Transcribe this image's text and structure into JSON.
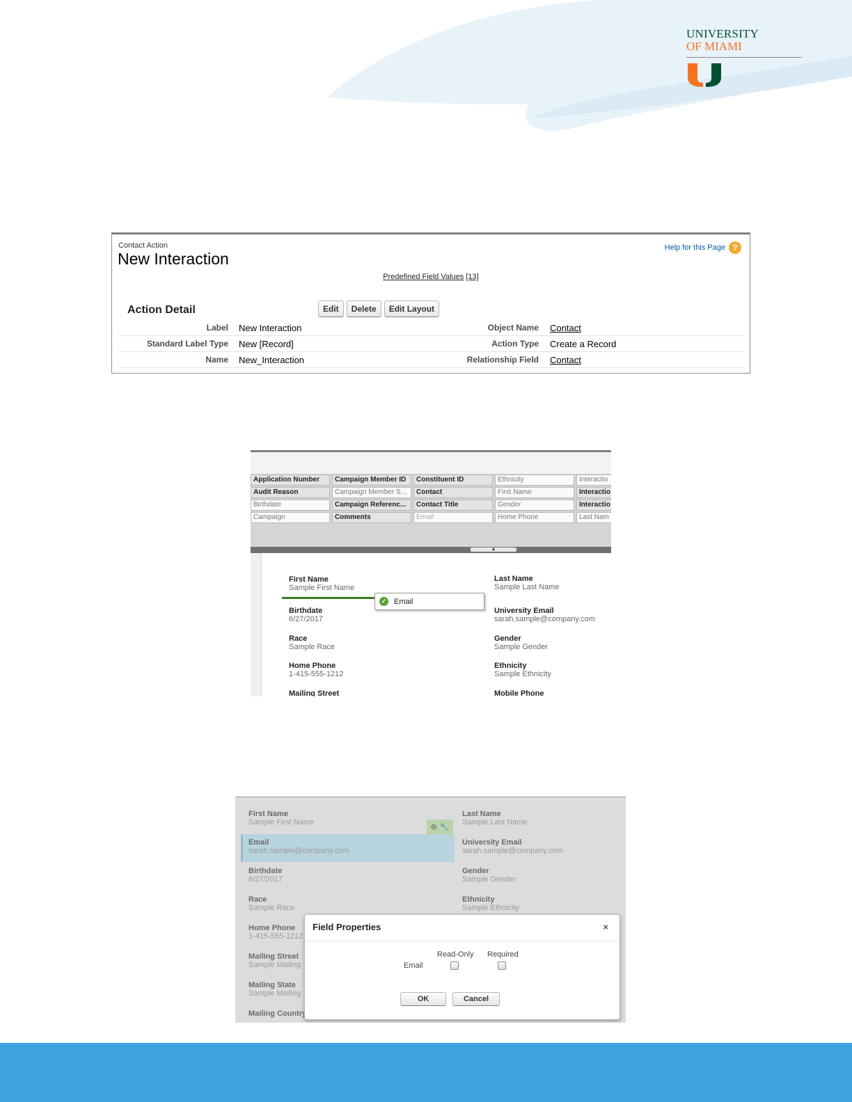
{
  "branding": {
    "university_line1": "UNIVERSITY",
    "university_line2": "OF MIAMI",
    "colors": {
      "green": "#005030",
      "orange": "#f47321",
      "footer_blue": "#3fa3e2",
      "wave": "#e6f1f8"
    }
  },
  "action_detail_page": {
    "kicker": "Contact Action",
    "title": "New Interaction",
    "help_link": "Help for this Page",
    "predefined_link": "Predefined Field Values",
    "predefined_count": "[13]",
    "section_title": "Action Detail",
    "buttons": {
      "edit": "Edit",
      "delete": "Delete",
      "edit_layout": "Edit Layout"
    },
    "rows": [
      {
        "label": "Label",
        "value": "New Interaction",
        "label2": "Object Name",
        "value2": "Contact"
      },
      {
        "label": "Standard Label Type",
        "value": "New [Record]",
        "label2": "Action Type",
        "value2": "Create a Record"
      },
      {
        "label": "Name",
        "value": "New_Interaction",
        "label2": "Relationship Field",
        "value2": "Contact"
      }
    ]
  },
  "layout_editor": {
    "palette_fields": [
      [
        "Application Number",
        "Campaign Member ID",
        "Constituent ID",
        "Ethnicity",
        "Interactio"
      ],
      [
        "Audit Reason",
        "Campaign Member S...",
        "Contact",
        "First Name",
        "Interactio"
      ],
      [
        "Birthdate",
        "Campaign Referenc...",
        "Contact Title",
        "Gender",
        "Interactio"
      ],
      [
        "Campaign",
        "Comments",
        "Email",
        "Home Phone",
        "Last Nam"
      ]
    ],
    "handle_glyph": "▲",
    "fields": {
      "first_name": {
        "label": "First Name",
        "value": "Sample First Name"
      },
      "last_name": {
        "label": "Last Name",
        "value": "Sample Last Name"
      },
      "birthdate": {
        "label": "Birthdate",
        "value": "6/27/2017"
      },
      "university_email": {
        "label": "University Email",
        "value": "sarah.sample@company.com"
      },
      "race": {
        "label": "Race",
        "value": "Sample Race"
      },
      "gender": {
        "label": "Gender",
        "value": "Sample Gender"
      },
      "home_phone": {
        "label": "Home Phone",
        "value": "1-415-555-1212"
      },
      "ethnicity": {
        "label": "Ethnicity",
        "value": "Sample Ethnicity"
      },
      "mailing_street": {
        "label": "Mailing Street"
      },
      "mobile_phone": {
        "label": "Mobile Phone"
      }
    },
    "drag_item": "Email"
  },
  "field_properties": {
    "fields": {
      "first_name": {
        "label": "First Name",
        "value": "Sample First Name"
      },
      "last_name": {
        "label": "Last Name",
        "value": "Sample Last Name"
      },
      "email": {
        "label": "Email",
        "value": "sarah.sample@company.com"
      },
      "university_email": {
        "label": "University Email",
        "value": "sarah.sample@company.com"
      },
      "birthdate": {
        "label": "Birthdate",
        "value": "6/27/2017"
      },
      "gender": {
        "label": "Gender",
        "value": "Sample Gender"
      },
      "race": {
        "label": "Race",
        "value": "Sample Race"
      },
      "ethnicity": {
        "label": "Ethnicity",
        "value": "Sample Ethnicity"
      },
      "home_phone": {
        "label": "Home Phone",
        "value": "1-415-555-1212"
      },
      "mailing_street": {
        "label": "Mailing Street",
        "value": "Sample Mailing"
      },
      "mailing_state": {
        "label": "Mailing State",
        "value": "Sample Mailing"
      },
      "mailing_country": {
        "label": "Mailing Country"
      }
    },
    "dialog": {
      "title": "Field Properties",
      "close": "×",
      "col_readonly": "Read-Only",
      "col_required": "Required",
      "field_name": "Email",
      "ok": "OK",
      "cancel": "Cancel"
    }
  }
}
